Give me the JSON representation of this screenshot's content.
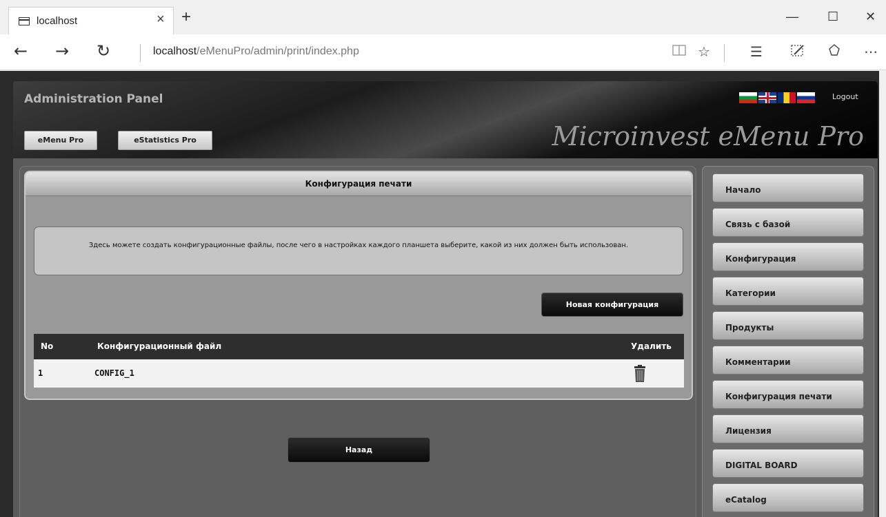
{
  "browser": {
    "tab_title": "localhost",
    "tab_close": "×",
    "new_tab": "+",
    "url_host": "localhost",
    "url_path": "/eMenuPro/admin/print/index.php",
    "win_minimize": "—",
    "win_maximize": "☐",
    "win_close": "✕"
  },
  "header": {
    "admin_title": "Administration Panel",
    "buttons": [
      "eMenu Pro",
      "eStatistics Pro"
    ],
    "brand": "Microinvest eMenu Pro",
    "logout": "Logout",
    "flags": [
      "bg-flag-icon",
      "gb-flag-icon",
      "ro-flag-icon",
      "ru-flag-icon"
    ]
  },
  "main": {
    "title": "Конфигурация печати",
    "info_text": "Здесь можете создать конфигурационные файлы, после чего в настройках каждого планшета выберите, какой из них должен быть использован.",
    "new_config_label": "Новая конфигурация",
    "table": {
      "columns": [
        "No",
        "Конфигурационный файл",
        "Удалить"
      ],
      "rows": [
        {
          "no": "1",
          "file": "CONFIG_1"
        }
      ]
    },
    "back_label": "Назад"
  },
  "sidebar": {
    "items": [
      {
        "label": "Начало"
      },
      {
        "label": "Связь с базой"
      },
      {
        "label": "Конфигурация"
      },
      {
        "label": "Категории"
      },
      {
        "label": "Продукты"
      },
      {
        "label": "Комментарии"
      },
      {
        "label": "Конфигурация печати"
      },
      {
        "label": "Лицензия"
      },
      {
        "label": "DIGITAL BOARD"
      },
      {
        "label": "eCatalog"
      }
    ]
  }
}
